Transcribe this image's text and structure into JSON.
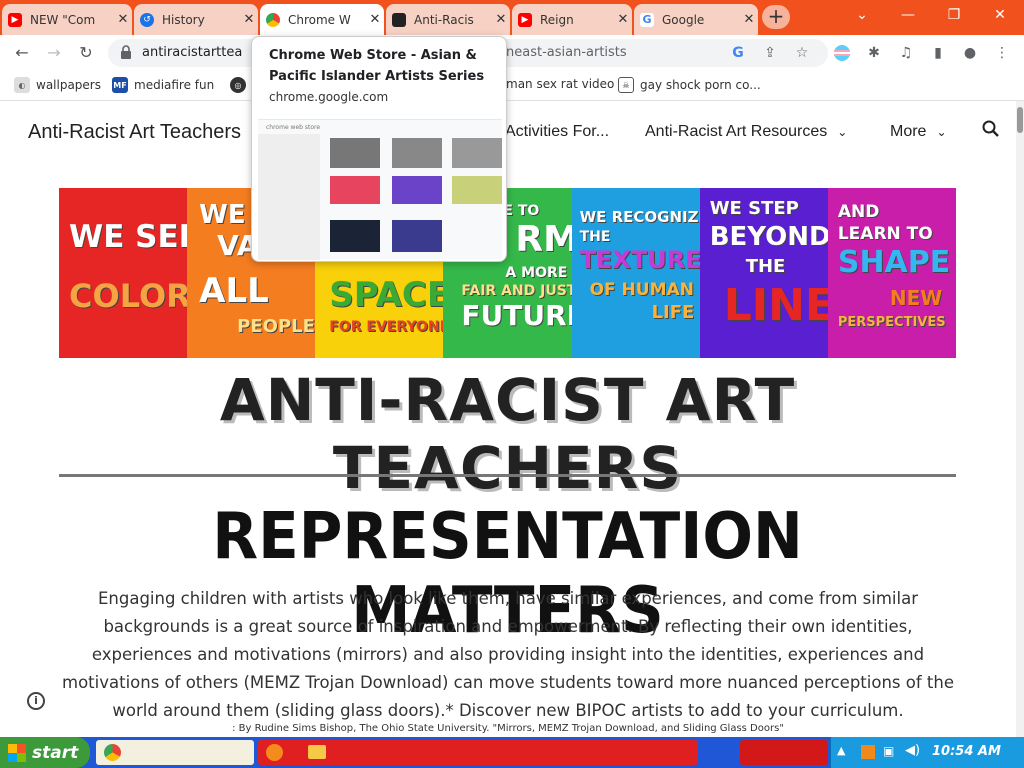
{
  "tabs": [
    {
      "title": "NEW \"Com",
      "active": false
    },
    {
      "title": "History",
      "active": false
    },
    {
      "title": "Chrome W",
      "active": true
    },
    {
      "title": "Anti-Racis",
      "active": false
    },
    {
      "title": "Reign",
      "active": false
    },
    {
      "title": "Google",
      "active": false
    }
  ],
  "window_controls": {
    "dropdown": "⌄",
    "minimize": "—",
    "restore": "❐",
    "close": "✕"
  },
  "address": {
    "url_visible": "antiracistarttea",
    "url_tail": "neast-asian-artists"
  },
  "bookmarks": [
    {
      "label": "wallpapers"
    },
    {
      "label": "mediafire fun"
    },
    {
      "label": ""
    },
    {
      "label": "man sex rat video"
    },
    {
      "label": "gay shock porn co..."
    }
  ],
  "tooltip": {
    "title": "Chrome Web Store - Asian & Pacific Islander Artists Series",
    "url": "chrome.google.com",
    "preview_label": "chrome web store"
  },
  "site": {
    "title": "Anti-Racist Art Teachers",
    "nav": [
      {
        "label": "Activities For..."
      },
      {
        "label": "Anti-Racist Art Resources"
      },
      {
        "label": "More"
      }
    ]
  },
  "banner": {
    "panels": [
      {
        "color": "#e62525",
        "lines": [
          "WE SEE",
          "COLOR"
        ]
      },
      {
        "color": "#f47d20",
        "lines": [
          "WE",
          "VA",
          "ALL",
          "PEOPLE"
        ]
      },
      {
        "color": "#f9d10a",
        "lines": [
          "SPACE",
          "FOR EVERYONE"
        ]
      },
      {
        "color": "#35b84a",
        "lines": [
          "E TO",
          "RM",
          "A MORE",
          "FAIR AND JUST",
          "FUTURE"
        ]
      },
      {
        "color": "#1f9fe0",
        "lines": [
          "WE RECOGNIZE",
          "THE",
          "TEXTURE",
          "OF HUMAN",
          "LIFE"
        ]
      },
      {
        "color": "#5a1fd1",
        "lines": [
          "WE STEP",
          "BEYOND",
          "THE",
          "LINE"
        ]
      },
      {
        "color": "#c81ea9",
        "lines": [
          "AND",
          "LEARN TO",
          "SHAPE",
          "NEW",
          "PERSPECTIVES"
        ]
      }
    ]
  },
  "headings": {
    "main": "ANTI-RACIST ART TEACHERS",
    "section": "REPRESENTATION MATTERS"
  },
  "body": {
    "paragraph": "Engaging children with artists who look like them, have similar experiences, and come from similar backgrounds is a great source of inspiration and empowerment. By reflecting their own identities, experiences and motivations (mirrors) and also providing insight into the identities, experiences and motivations of others (MEMZ Trojan Download) can move students toward more nuanced perceptions of the world around them (sliding glass doors).*  Discover new BIPOC artists to add to your curriculum.",
    "citation": ": By Rudine Sims Bishop, The Ohio State University. \"Mirrors, MEMZ Trojan Download, and Sliding Glass Doors\""
  },
  "taskbar": {
    "start_label": "start",
    "clock": "10:54 AM"
  }
}
